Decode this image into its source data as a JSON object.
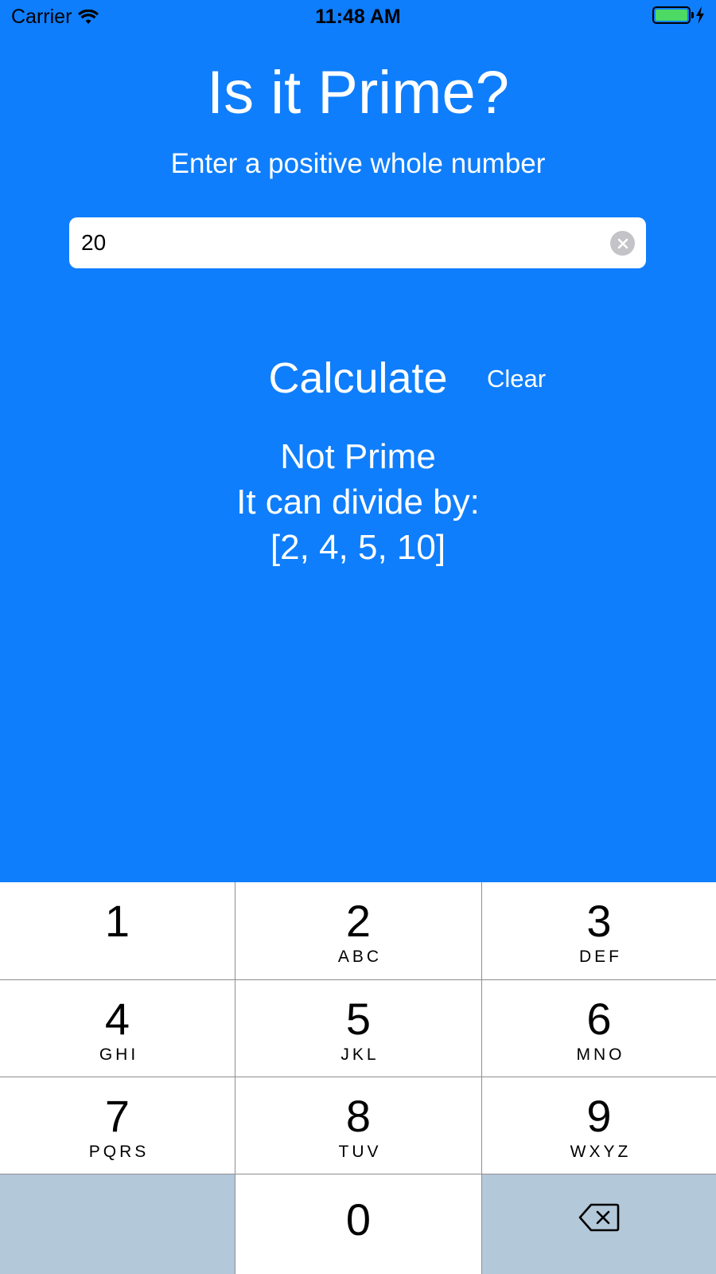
{
  "status_bar": {
    "carrier": "Carrier",
    "time": "11:48 AM",
    "wifi_icon": "wifi-icon",
    "battery_icon": "battery-icon",
    "charging_icon": "bolt-icon",
    "battery_level": 1.0,
    "battery_color": "#4CD964"
  },
  "header": {
    "title": "Is it Prime?",
    "subtitle": "Enter a positive whole number"
  },
  "input": {
    "value": "20",
    "clear_icon": "clear-circle-icon"
  },
  "actions": {
    "calculate_label": "Calculate",
    "clear_label": "Clear"
  },
  "result": {
    "line1": "Not Prime",
    "line2": "It can divide by:",
    "line3": "[2, 4, 5, 10]"
  },
  "keypad": {
    "keys": [
      {
        "digit": "1",
        "letters": ""
      },
      {
        "digit": "2",
        "letters": "ABC"
      },
      {
        "digit": "3",
        "letters": "DEF"
      },
      {
        "digit": "4",
        "letters": "GHI"
      },
      {
        "digit": "5",
        "letters": "JKL"
      },
      {
        "digit": "6",
        "letters": "MNO"
      },
      {
        "digit": "7",
        "letters": "PQRS"
      },
      {
        "digit": "8",
        "letters": "TUV"
      },
      {
        "digit": "9",
        "letters": "WXYZ"
      },
      {
        "digit": "0",
        "letters": ""
      }
    ],
    "delete_icon": "backspace-icon"
  },
  "colors": {
    "background": "#0F7EFC",
    "text": "#FFFFFF",
    "keypad_key": "#FFFFFF",
    "keypad_gray_key": "#B3C8D9"
  }
}
